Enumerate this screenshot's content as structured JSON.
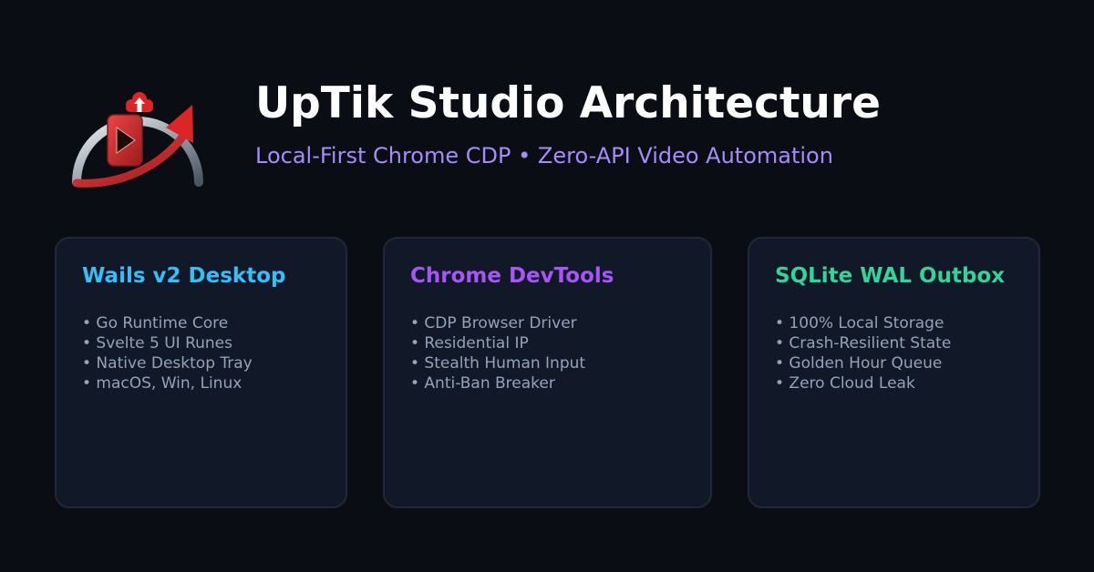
{
  "header": {
    "title": "UpTik Studio Architecture",
    "subtitle": "Local-First Chrome CDP • Zero-API Video Automation"
  },
  "cards": [
    {
      "title": "Wails v2 Desktop",
      "accent": "#38bdf8",
      "items": [
        "• Go Runtime Core",
        "• Svelte 5 UI Runes",
        "• Native Desktop Tray",
        "• macOS, Win, Linux"
      ]
    },
    {
      "title": "Chrome DevTools",
      "accent": "#a855f7",
      "items": [
        "• CDP Browser Driver",
        "• Residential IP",
        "• Stealth Human Input",
        "• Anti-Ban Breaker"
      ]
    },
    {
      "title": "SQLite WAL Outbox",
      "accent": "#34d399",
      "items": [
        "• 100% Local Storage",
        "• Crash-Resilient State",
        "• Golden Hour Queue",
        "• Zero Cloud Leak"
      ]
    }
  ],
  "colors": {
    "background": "#0a0d14",
    "card_background": "#111827",
    "card_border": "#1f2937",
    "title": "#ffffff",
    "subtitle": "#a78bfa",
    "item_text": "#94a3b8",
    "logo_red": "#dc2626"
  },
  "icons": {
    "logo": "uptik-logo-icon"
  }
}
